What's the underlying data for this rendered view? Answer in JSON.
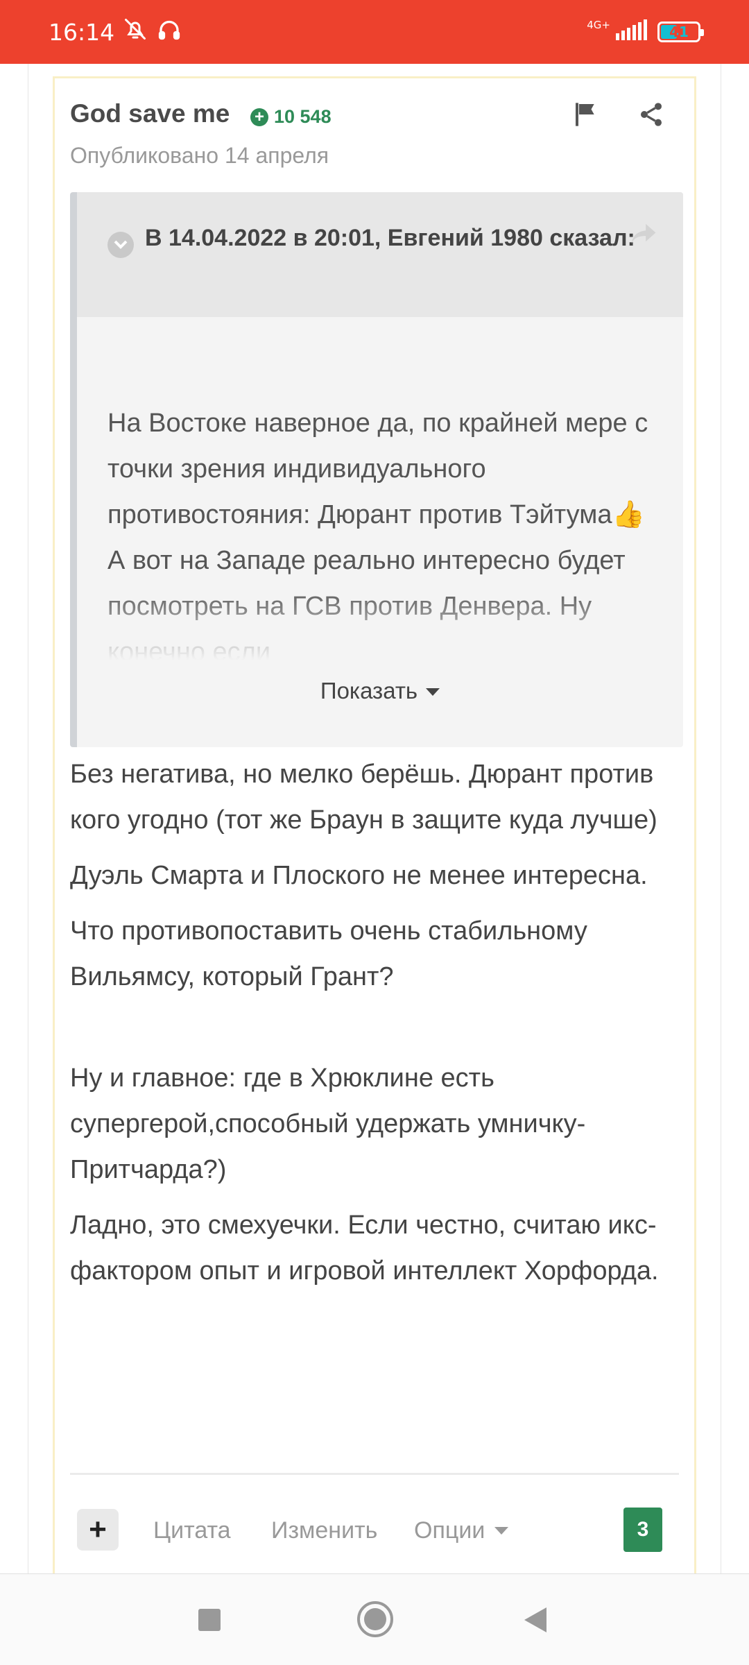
{
  "status_bar": {
    "time": "16:14",
    "network": "4G+",
    "battery": "41",
    "battery_level": 0.41,
    "icons": [
      "bell-off-icon",
      "headphones-icon",
      "signal-icon",
      "battery-icon"
    ]
  },
  "post": {
    "author": "God save me",
    "reputation": "10 548",
    "published": "Опубликовано 14 апреля",
    "icons": [
      "flag-icon",
      "share-icon"
    ],
    "quote": {
      "citation": "В 14.04.2022 в 20:01, Евгений 1980 сказал:",
      "text": "На Востоке наверное да, по крайней мере с точки зрения индивидуального противостояния: Дюрант против Тэйтума👍 А вот на Западе реально интересно будет посмотреть на ГСВ против Денвера. Ну конечно если",
      "show_more": "Показать"
    },
    "paragraphs": [
      "Без негатива, но мелко берёшь. Дюрант против кого угодно (тот же Браун в защите куда лучше)",
      "Дуэль Смарта и Плоского не менее интересна.",
      "Что противопоставить очень стабильному Вильямсу, который Грант?",
      "Ну и главное: где в Хрюклине есть супергерой,способный удержать умничку-Притчарда?)",
      "Ладно, это смехуечки. Если честно, считаю икс-фактором опыт и игровой интеллект Хорфорда."
    ],
    "footer": {
      "plus": "+",
      "quote": "Цитата",
      "edit": "Изменить",
      "options": "Опции",
      "count": "3"
    }
  },
  "nav_bar": {
    "icons": [
      "recents-icon",
      "home-icon",
      "back-icon"
    ]
  },
  "colors": {
    "status_bar": "#ed412d",
    "accent_green": "#2e8b57",
    "quote_bg": "#f4f4f4",
    "post_border": "#f9efc6"
  }
}
